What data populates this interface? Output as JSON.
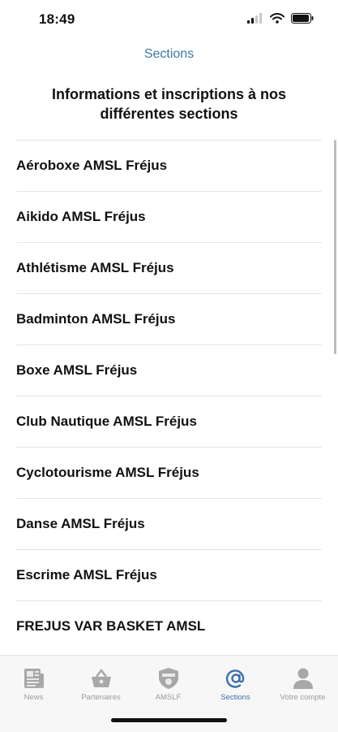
{
  "status_bar": {
    "time": "18:49"
  },
  "header": {
    "nav_title": "Sections",
    "heading": "Informations et inscriptions à nos différentes sections"
  },
  "sections": [
    {
      "label": "Aéroboxe AMSL Fréjus"
    },
    {
      "label": "Aikido AMSL Fréjus"
    },
    {
      "label": "Athlétisme AMSL Fréjus"
    },
    {
      "label": "Badminton AMSL Fréjus"
    },
    {
      "label": "Boxe AMSL Fréjus"
    },
    {
      "label": "Club Nautique AMSL Fréjus"
    },
    {
      "label": "Cyclotourisme AMSL Fréjus"
    },
    {
      "label": "Danse AMSL Fréjus"
    },
    {
      "label": "Escrime AMSL Fréjus"
    },
    {
      "label": "FREJUS VAR BASKET AMSL"
    }
  ],
  "tab_bar": {
    "tabs": [
      {
        "label": "News",
        "icon": "newspaper-icon",
        "active": false
      },
      {
        "label": "Partenaires",
        "icon": "basket-icon",
        "active": false
      },
      {
        "label": "AMSLF",
        "icon": "shield-icon",
        "active": false
      },
      {
        "label": "Sections",
        "icon": "at-sign-icon",
        "active": true
      },
      {
        "label": "Votre compte",
        "icon": "person-icon",
        "active": false
      }
    ]
  },
  "colors": {
    "accent": "#3b78a8",
    "active_tab": "#3b6fb0",
    "inactive_tab": "#9a9a9a"
  }
}
